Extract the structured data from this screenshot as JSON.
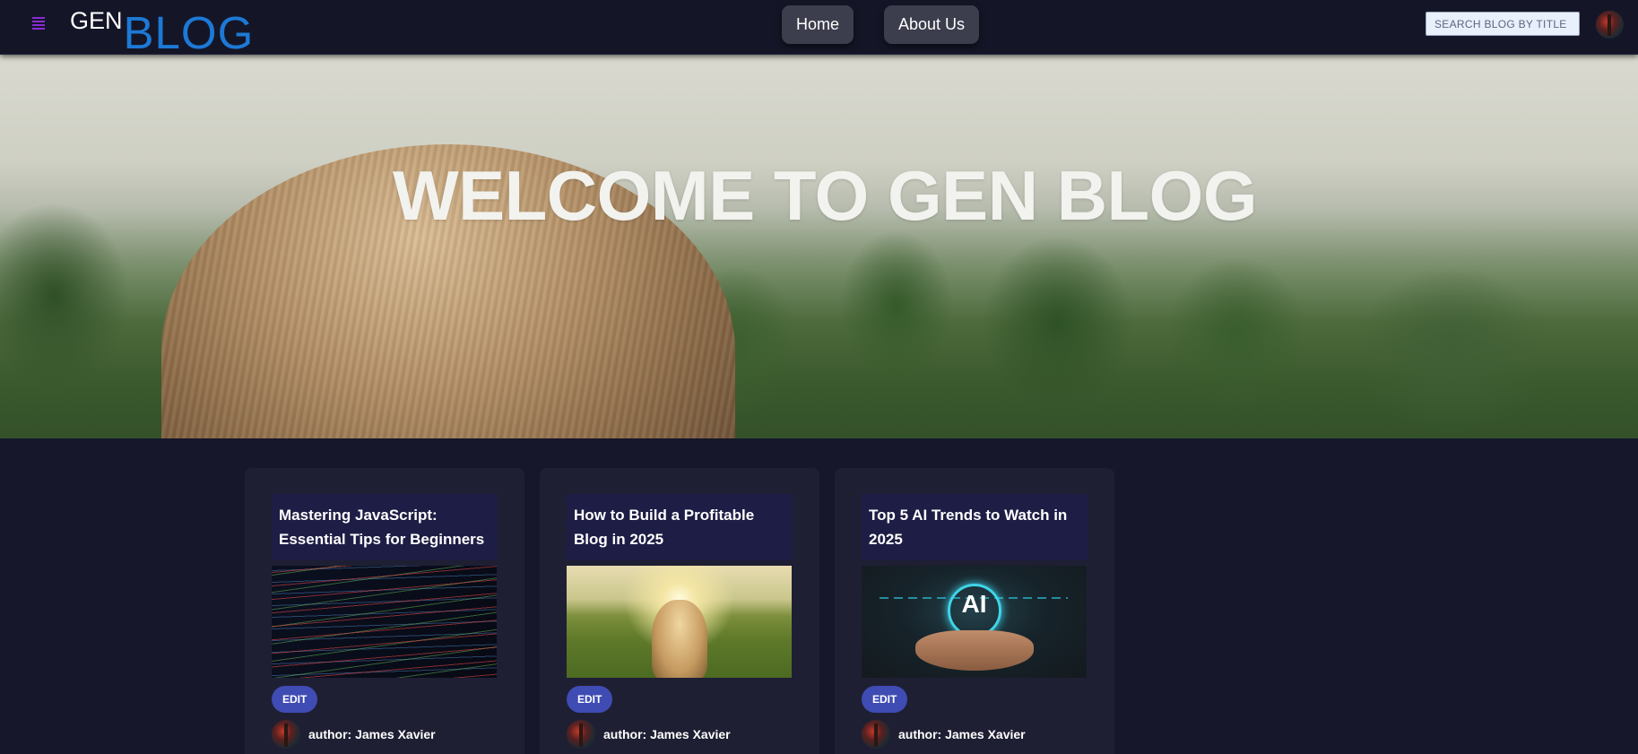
{
  "navbar": {
    "logo_gen": "GEN",
    "logo_blog": "BLOG",
    "links": [
      {
        "label": "Home"
      },
      {
        "label": "About Us"
      }
    ],
    "search_placeholder": "SEARCH BLOG BY TITLE ...",
    "search_value": ""
  },
  "hero": {
    "title": "WELCOME TO GEN BLOG"
  },
  "cards": [
    {
      "title": "Mastering JavaScript: Essential Tips for Beginners",
      "edit_label": "EDIT",
      "author": "author: James Xavier"
    },
    {
      "title": "How to Build a Profitable Blog in 2025",
      "edit_label": "EDIT",
      "author": "author: James Xavier"
    },
    {
      "title": "Top 5 AI Trends to Watch in 2025",
      "edit_label": "EDIT",
      "author": "author: James Xavier",
      "image_text": "AI"
    }
  ],
  "colors": {
    "background": "#16172a",
    "navbar": "#141627",
    "logo_accent": "#1d79d6",
    "menu_icon": "#8a2bd6",
    "card": "#1f1f34",
    "card_title_bg": "#1e1d45",
    "edit_button": "#3f4cb3"
  }
}
